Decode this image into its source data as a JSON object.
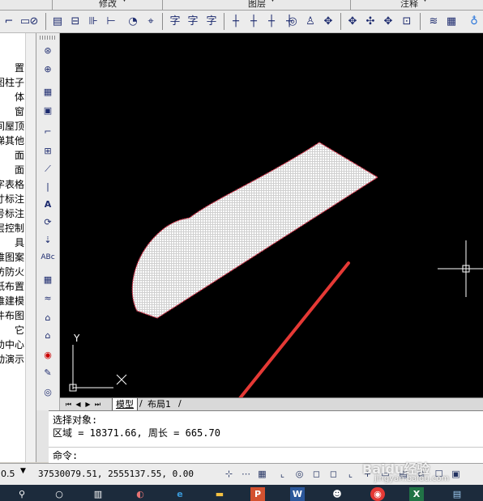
{
  "menu": {
    "items": [
      "修改",
      "图层",
      "注释"
    ]
  },
  "toolbar": {
    "icons": [
      "polyline-icon",
      "rect-icon",
      "hatch-icon",
      "layer-icon",
      "dimension-icon",
      "align-icon",
      "measure-icon",
      "text-style-icon",
      "text-icon",
      "font-icon",
      "grid-a-icon",
      "grid-b-icon",
      "grid-c-icon",
      "grid-d-icon",
      "circle-icon",
      "person-icon",
      "move-icon",
      "pan-icon",
      "stack-icon",
      "bulb-icon"
    ]
  },
  "left_panel": {
    "items": [
      "置",
      "图柱子",
      "体",
      "窗",
      "房间屋顶",
      "楼梯其他",
      "面",
      "面",
      "文字表格",
      "尺寸标注",
      "符号标注",
      "图层控制",
      "具",
      "三维图案",
      "消防防火",
      "图纸布置",
      "三维建模",
      "文件布图",
      "它",
      "帮助中心",
      "动演示"
    ]
  },
  "vtoolbar": {
    "icons": [
      "camera-icon",
      "zoom-window-icon",
      "table-icon",
      "image-icon",
      "stair-icon",
      "window-icon",
      "elevation-icon",
      "line-icon",
      "text-a-icon",
      "rotate-icon",
      "dimension-z-icon",
      "abc-icon",
      "grid-icon",
      "wave-icon",
      "door-icon",
      "house-icon",
      "eye-icon",
      "pencil-icon",
      "view-icon"
    ]
  },
  "tabs": {
    "model": "模型",
    "layout1": "布局1"
  },
  "command": {
    "line1": "选择对象:",
    "line2": "区域 = 18371.66, 周长 = 665.70",
    "prompt": "命令:"
  },
  "status": {
    "scale_value": "0.5",
    "coordinates": "37530079.51, 2555137.55, 0.00"
  },
  "watermark": {
    "brand": "Baidu经验",
    "url": "jingyan.baidu.com"
  },
  "ucs": {
    "y_label": "Y",
    "x_label": "X"
  },
  "colors": {
    "canvas_bg": "#000000",
    "shape_fill": "#e8e8e8",
    "shape_outline": "#d8334a",
    "annotation_arrow": "#e53935"
  }
}
